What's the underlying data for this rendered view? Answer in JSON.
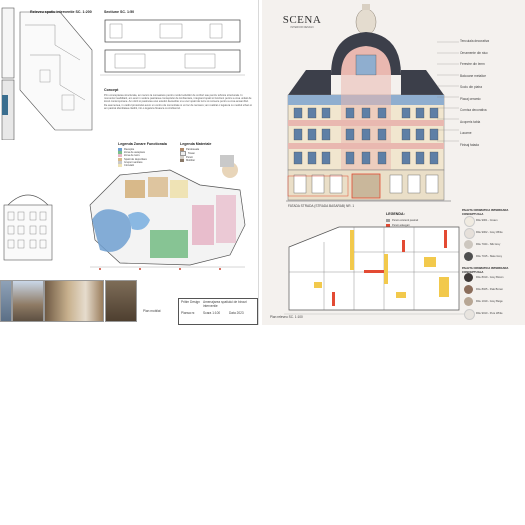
{
  "left_sheet": {
    "plan_title": "Releveu spatiu interventie SC. 1:200",
    "section_title": "Sectiune SC. 1:50",
    "concept_heading": "Concept",
    "concept_text": "Prin conceptarea structurala, am recurs la cunoastere pentru modul solutiilor de confort sau pentru tehnica structurala. In momentul reabilitarii, am avut in vedere pastrarea conceptului de Ambientare, integrand spatii si functiuni pentru a crea unitati de locuit contemporane. Am dorit si pastrarea unei estetici deosebite si a unor spatii de lucru si recreere pentru a crea ansamblul. De asemenea, in cadrul proiectului avem un centru de comunitate si un loc de recreere; am realizat o legatura cu mediul urban si am pastrat identitatea cladirii, intr-o legatura fireasca cu Ambientul.",
    "legend1_title": "Legenda Zonare Functionala",
    "legend2_title": "Legenda Materiale",
    "legend1_items": [
      "Receptie",
      "Zona de asteptare",
      "Zona de lucru",
      "Spatii de depozitare",
      "Grupuri sanitare",
      "Circulatii"
    ],
    "legend2_items": [
      "Pardoseala",
      "Tavan",
      "Pereti",
      "Mobilier"
    ],
    "plan_label": "Plan mobilat",
    "titleblock": [
      "Pritim Design",
      "Amenajarea spatiului de birouri interventie",
      "Plansa nr.",
      "Scara 1:100",
      "Data 2023"
    ]
  },
  "right_sheet": {
    "logo_text": "SCENA",
    "logo_sub": "INTERIOR DESIGN",
    "facade_annotations": [
      "Tencuiala decorativa",
      "Ornamente din stuc",
      "Ferestre din lemn",
      "Balcoane metalice",
      "Soclu din piatra",
      "Placaj ceramic",
      "Cornisa decorativa",
      "Acoperis tabla",
      "Lucarne",
      "Finisaj fatada"
    ],
    "facade_caption": "FATADA STRADA (STRADA BASARAB) NR. 1",
    "legend_title": "LEGENDA:",
    "legend_items": [
      {
        "label": "Pereti existenti pastrati",
        "color": "#9e9e9e"
      },
      {
        "label": "Pereti adaugati",
        "color": "#e34a33"
      },
      {
        "label": "Pereti demolati",
        "color": "#f2c94c"
      }
    ],
    "plan_caption": "Plan releveu SC. 1:100",
    "palette1_title": "PALETA CROMATICA INTERIOARA CONCEPTUALA",
    "palette1": [
      {
        "label": "RAL 9001 - Cream",
        "color": "#f0ebe1"
      },
      {
        "label": "RAL 9002 - Grey White",
        "color": "#e6e0da"
      },
      {
        "label": "RAL 7044 - Silk Grey",
        "color": "#cdc7bf"
      },
      {
        "label": "RAL 7015 - Slate Grey",
        "color": "#4f4f4f"
      }
    ],
    "palette2_title": "PALETA CROMATICA INTERIOARA CONCEPTUALA",
    "palette2": [
      {
        "label": "RAL 8019 - Grey Brown",
        "color": "#3f3a38"
      },
      {
        "label": "RAL 8025 - Pale Brown",
        "color": "#8c6e5c"
      },
      {
        "label": "RAL 1019 - Grey Beige",
        "color": "#b8a795"
      },
      {
        "label": "RAL 9010 - Pure White",
        "color": "#e8e4df"
      }
    ]
  },
  "colors": {
    "facade_blue": "#8faecf",
    "facade_pink": "#e9b8b0",
    "facade_cream": "#f1e6cf",
    "roof_dark": "#3c3f4a",
    "plan_blue": "#6e9fd0",
    "plan_green": "#7bbf8a",
    "plan_pink": "#e7b7c8",
    "plan_tan": "#d8b98a"
  }
}
